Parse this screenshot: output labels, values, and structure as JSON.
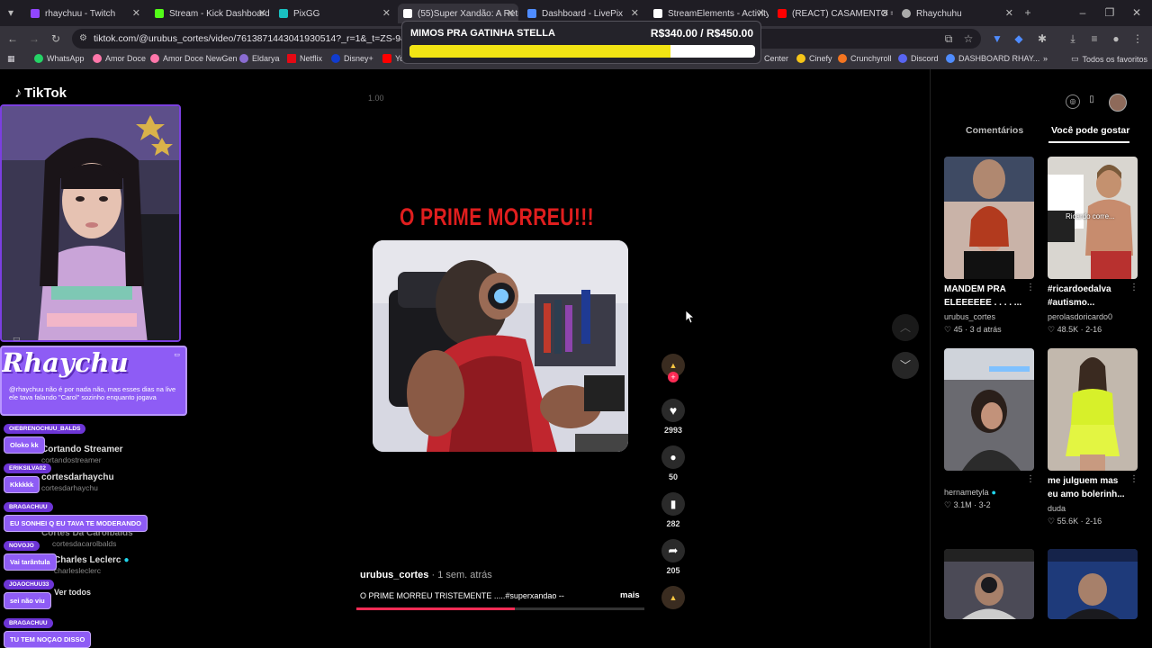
{
  "browser": {
    "tabs": [
      {
        "title": "rhaychuu - Twitch",
        "color": "#9146ff"
      },
      {
        "title": "Stream - Kick Dashboard",
        "color": "#53fc18"
      },
      {
        "title": "PixGG",
        "color": "#19c0c0"
      },
      {
        "title": "(55)Super Xandão: A Retr",
        "color": "#ffffff",
        "active": true
      },
      {
        "title": "Dashboard - LivePix",
        "color": "#4f8cff"
      },
      {
        "title": "StreamElements - Activity",
        "color": "#ffffff"
      },
      {
        "title": "(REACT) CASAMENTO =",
        "color": "#ff0000"
      },
      {
        "title": "Rhaychuhu",
        "color": "#aaaaaa"
      }
    ],
    "url": "tiktok.com/@urubus_cortes/video/7613871443041930514?_r=1&_t=ZS-94dfGWW",
    "bookmarks": [
      "WhatsApp",
      "Amor Doce",
      "Amor Doce NewGen",
      "Eldarya",
      "Netflix",
      "Disney+",
      "Yo",
      "Center",
      "Cinefy",
      "Crunchyroll",
      "Discord",
      "DASHBOARD RHAY..."
    ],
    "bookmarks_all": "Todos os favoritos"
  },
  "donation_goal": {
    "title": "MIMOS PRA GATINHA STELLA",
    "amount": "R$340.00 / R$450.00",
    "progress_fraction": 0.756
  },
  "tiktok": {
    "logo": "TikTok",
    "speed": "1.00",
    "video_title": "O PRIME MORREU!!!",
    "likes": "2993",
    "comments": "50",
    "saves": "282",
    "shares": "205",
    "author": "urubus_cortes",
    "date": " · 1 sem. atrás",
    "description": "O PRIME MORREU TRISTEMENTE .....#superxandao --",
    "more": "mais",
    "progress_fraction": 0.55,
    "tabs": {
      "comments": "Comentários",
      "related": "Você pode gostar"
    },
    "recommendations": [
      {
        "title": "MANDEM PRA ELEEEEEE . . . . ...",
        "author": "urubus_cortes",
        "likes": "45",
        "age": "3 d atrás",
        "caption": ""
      },
      {
        "title": "#ricardoedalva #autismo...",
        "author": "perolasdoricardo0",
        "likes": "48.5K",
        "age": "2-16",
        "caption": "Ricardo corre..."
      },
      {
        "title": "",
        "author": "hernametyla",
        "likes": "3.1M",
        "age": "3-2",
        "caption": ""
      },
      {
        "title": "me julguem mas eu amo bolerinh...",
        "author": "duda",
        "likes": "55.6K",
        "age": "2-16",
        "caption": ""
      }
    ]
  },
  "stream_overlay": {
    "banner_name": "Rhaychu",
    "banner_message": "@rhaychuu não é por nada não, mas esses dias na live ele tava falando \"Carol\" sozinho enquanto jogava",
    "chat": [
      {
        "name": "OIEBRENOCHUU_BALDS",
        "text": "Oloko kk"
      },
      {
        "name": "ERIKSILVA02",
        "text": "Kkkkkk"
      },
      {
        "name": "BRAGACHUU",
        "text": "EU SONHEI Q EU TAVA TE MODERANDO"
      },
      {
        "name": "NOVOJO",
        "text": "Vai tarântula"
      },
      {
        "name": "JOAOCHUU33",
        "text": "sei não viu"
      },
      {
        "name": "BRAGACHUU",
        "text": "TU TEM NOÇAO DISSO"
      }
    ],
    "sidebar": [
      {
        "name": "Cortando Streamer",
        "handle": "cortandostreamer"
      },
      {
        "name": "cortesdarhaychu",
        "handle": "cortesdarhaychu"
      },
      {
        "name": "Cortes Da Carolbalds",
        "handle": "cortesdacarolbalds"
      },
      {
        "name": "Charles Leclerc",
        "handle": "charlesleclerc"
      },
      {
        "name": "Ver todos",
        "handle": ""
      }
    ]
  }
}
